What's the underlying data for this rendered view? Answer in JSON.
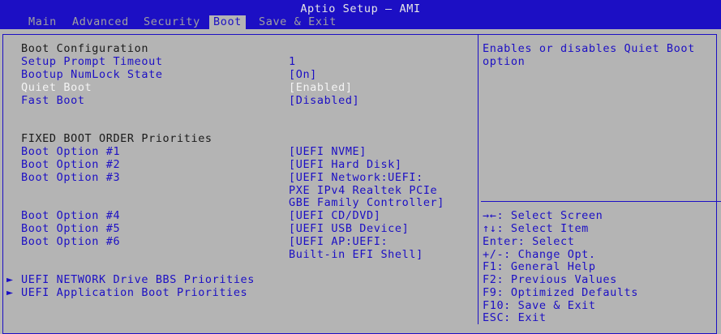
{
  "window": {
    "title": "Aptio Setup – AMI"
  },
  "tabs": [
    {
      "label": "Main"
    },
    {
      "label": "Advanced"
    },
    {
      "label": "Security"
    },
    {
      "label": "Boot"
    },
    {
      "label": "Save & Exit"
    }
  ],
  "active_tab": "Boot",
  "boot_config": {
    "heading": "Boot Configuration",
    "setup_prompt_timeout": {
      "label": "Setup Prompt Timeout",
      "value": "1"
    },
    "bootup_numlock_state": {
      "label": "Bootup NumLock State",
      "value": "[On]"
    },
    "quiet_boot": {
      "label": "Quiet Boot",
      "value": "[Enabled]"
    },
    "fast_boot": {
      "label": "Fast Boot",
      "value": "[Disabled]"
    }
  },
  "fixed_order": {
    "heading": "FIXED BOOT ORDER Priorities",
    "options": [
      {
        "label": "Boot Option #1",
        "value": [
          "[UEFI NVME]"
        ]
      },
      {
        "label": "Boot Option #2",
        "value": [
          "[UEFI Hard Disk]"
        ]
      },
      {
        "label": "Boot Option #3",
        "value": [
          "[UEFI Network:UEFI:",
          "PXE IPv4 Realtek PCIe",
          "GBE Family Controller]"
        ]
      },
      {
        "label": "Boot Option #4",
        "value": [
          "[UEFI CD/DVD]"
        ]
      },
      {
        "label": "Boot Option #5",
        "value": [
          "[UEFI USB Device]"
        ]
      },
      {
        "label": "Boot Option #6",
        "value": [
          "[UEFI AP:UEFI:",
          "Built-in EFI Shell]"
        ]
      }
    ]
  },
  "submenus": [
    {
      "arrow": "►",
      "label": "UEFI NETWORK Drive BBS Priorities"
    },
    {
      "arrow": "►",
      "label": "UEFI Application Boot Priorities"
    }
  ],
  "help": {
    "description": [
      "Enables or disables Quiet Boot",
      "option"
    ],
    "keys": [
      "→←: Select Screen",
      "↑↓: Select Item",
      "Enter: Select",
      "+/-: Change Opt.",
      "F1: General Help",
      "F2: Previous Values",
      "F9: Optimized Defaults",
      "F10: Save & Exit",
      "ESC: Exit"
    ]
  },
  "colors": {
    "background": "#b4b4b4",
    "accent_blue": "#1c0fc4",
    "selected_text": "#f4f4f4",
    "inactive_tab": "#a0a0a0"
  }
}
